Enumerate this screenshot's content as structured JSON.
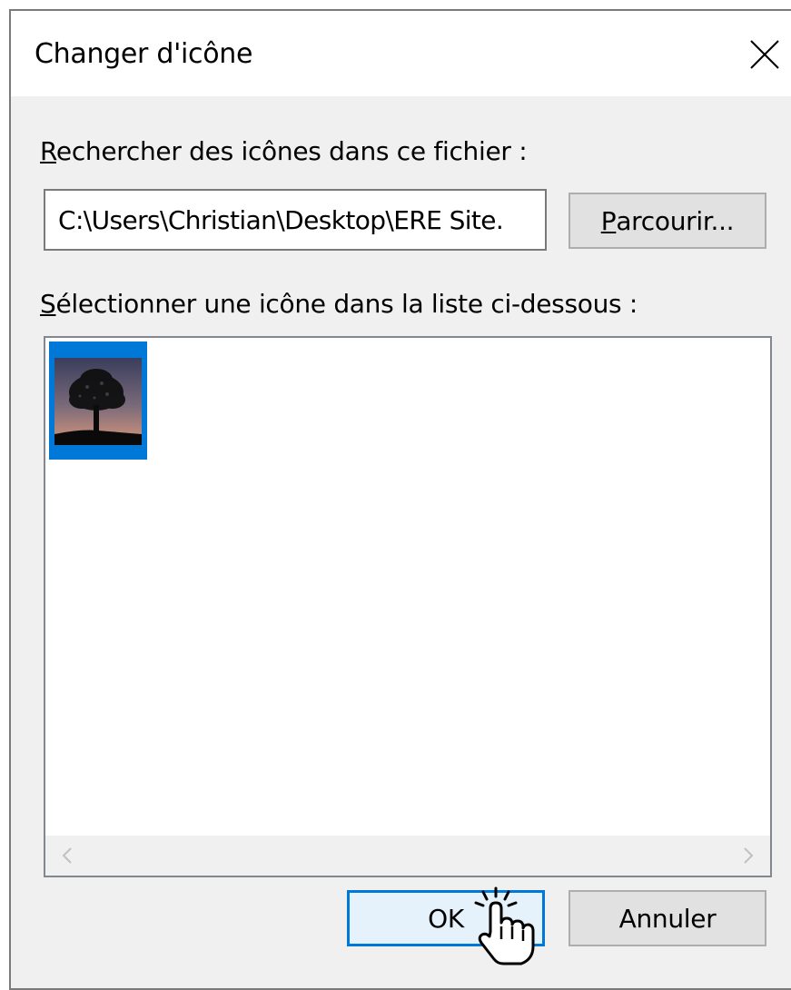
{
  "dialog": {
    "title": "Changer d'icône"
  },
  "search": {
    "label_mnemonic": "R",
    "label_rest": "echercher des icônes dans ce fichier :",
    "path_value": "C:\\Users\\Christian\\Desktop\\ERE Site.",
    "browse_mnemonic": "P",
    "browse_rest": "arcourir..."
  },
  "select": {
    "label_mnemonic": "S",
    "label_rest": "électionner une icône dans la liste ci-dessous :",
    "selected_icon": "tree-silhouette-icon"
  },
  "footer": {
    "ok_label": "OK",
    "cancel_label": "Annuler"
  },
  "colors": {
    "accent": "#0078d7",
    "window_bg": "#f0f0f0",
    "button_bg": "#e1e1e1"
  }
}
